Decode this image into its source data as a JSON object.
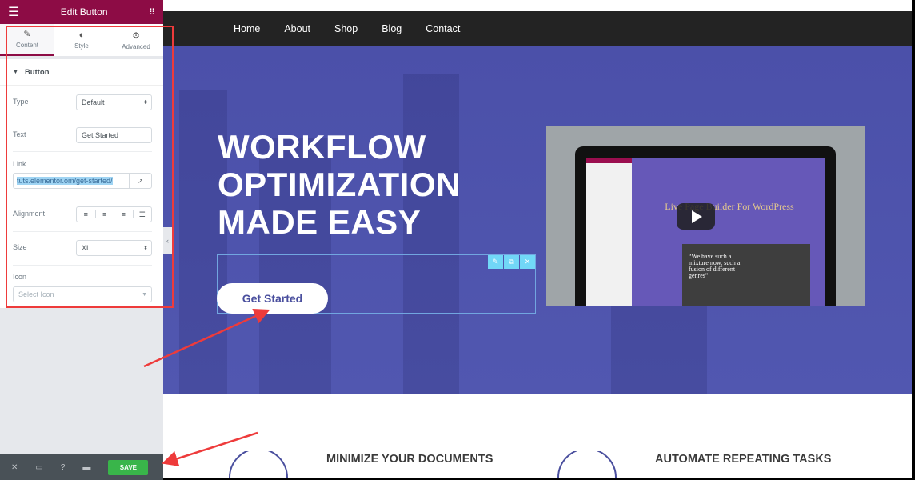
{
  "panel": {
    "title": "Edit Button",
    "tabs": [
      {
        "label": "Content",
        "icon": "pencil-icon",
        "active": true
      },
      {
        "label": "Style",
        "icon": "half-circle-icon"
      },
      {
        "label": "Advanced",
        "icon": "gear-icon"
      }
    ],
    "section": "Button",
    "fields": {
      "type": {
        "label": "Type",
        "value": "Default"
      },
      "text": {
        "label": "Text",
        "value": "Get Started"
      },
      "link": {
        "label": "Link",
        "value": "tuts.elementor.om/get-started/"
      },
      "alignment": {
        "label": "Alignment",
        "options": [
          "left",
          "center",
          "right",
          "justify"
        ]
      },
      "size": {
        "label": "Size",
        "value": "XL"
      },
      "icon": {
        "label": "Icon",
        "placeholder": "Select Icon"
      }
    },
    "footer": {
      "save_label": "SAVE"
    }
  },
  "site": {
    "nav": [
      "Home",
      "About",
      "Shop",
      "Blog",
      "Contact"
    ],
    "headline": [
      "WORKFLOW",
      "OPTIMIZATION",
      "MADE EASY"
    ],
    "cta": "Get Started",
    "video": {
      "title": "Live Page Builder For WordPress",
      "quote": "“We have such a mixture now, such a fusion of different genres”"
    },
    "features": [
      "MINIMIZE YOUR DOCUMENTS",
      "AUTOMATE REPEATING TASKS"
    ]
  },
  "colors": {
    "panel_header": "#8d0c45",
    "hero": "#4b50a9",
    "save": "#39b54a",
    "annotation": "#ee3b3b"
  }
}
